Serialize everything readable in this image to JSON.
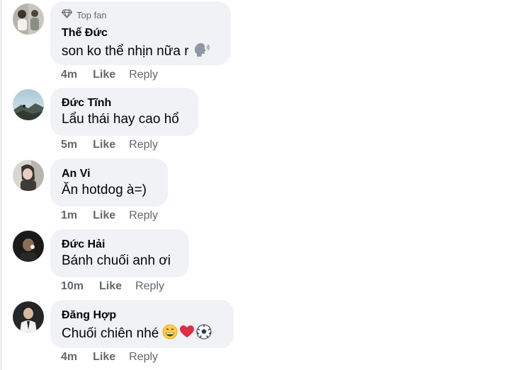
{
  "comments": [
    {
      "badge": "Top fan",
      "author": "Thế Đức",
      "text": "son ko thể nhịn nữa r",
      "emojis": [
        "speaking-head"
      ],
      "time": "4m",
      "like": "Like",
      "reply": "Reply"
    },
    {
      "author": "Đức Tĩnh",
      "text": "Lẩu thái hay cao hổ",
      "emojis": [],
      "time": "5m",
      "like": "Like",
      "reply": "Reply"
    },
    {
      "author": "An Vi",
      "text": "Ăn hotdog à=)",
      "emojis": [],
      "time": "1m",
      "like": "Like",
      "reply": "Reply"
    },
    {
      "author": "Đức Hải",
      "text": "Bánh chuối anh ơi",
      "emojis": [],
      "time": "10m",
      "like": "Like",
      "reply": "Reply"
    },
    {
      "author": "Đăng Hợp",
      "text": "Chuối chiên nhé",
      "emojis": [
        "grinning-face",
        "red-heart",
        "soccer-ball"
      ],
      "time": "4m",
      "like": "Like",
      "reply": "Reply"
    }
  ],
  "colors": {
    "bubble": "#f0f2f5",
    "meta_text": "#65676b",
    "body_text": "#050505"
  }
}
